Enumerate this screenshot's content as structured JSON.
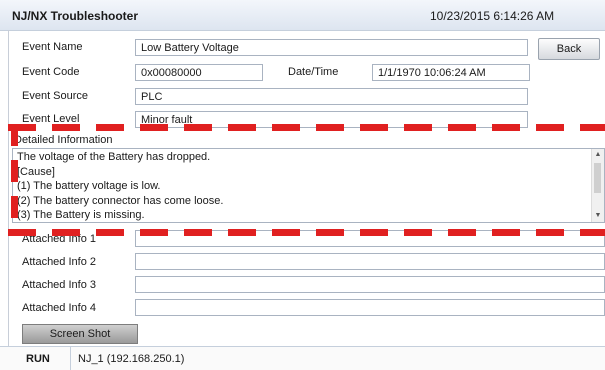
{
  "header": {
    "title": "NJ/NX Troubleshooter",
    "datetime": "10/23/2015 6:14:26 AM"
  },
  "event": {
    "name_label": "Event Name",
    "name_value": "Low Battery Voltage",
    "code_label": "Event Code",
    "code_value": "0x00080000",
    "datetime_label": "Date/Time",
    "datetime_value": "1/1/1970 10:06:24 AM",
    "source_label": "Event Source",
    "source_value": "PLC",
    "level_label": "Event Level",
    "level_value": "Minor fault"
  },
  "buttons": {
    "back": "Back",
    "screenshot": "Screen Shot"
  },
  "details": {
    "label": "Detailed Information",
    "lines": [
      "The voltage of the Battery has dropped.",
      "[Cause]",
      "(1) The battery voltage is low.",
      "(2) The battery connector has come loose.",
      "(3) The Battery is missing."
    ]
  },
  "attached": [
    {
      "label": "Attached Info 1",
      "value": ""
    },
    {
      "label": "Attached Info 2",
      "value": ""
    },
    {
      "label": "Attached Info 3",
      "value": ""
    },
    {
      "label": "Attached Info 4",
      "value": ""
    }
  ],
  "status": {
    "mode": "RUN",
    "connection": "NJ_1 (192.168.250.1)"
  },
  "colors": {
    "highlight_dash": "#e02020",
    "header_bg": "#dde5f0"
  },
  "icons": {
    "scroll_up": "scroll-up-arrow-icon",
    "scroll_down": "scroll-down-arrow-icon"
  }
}
